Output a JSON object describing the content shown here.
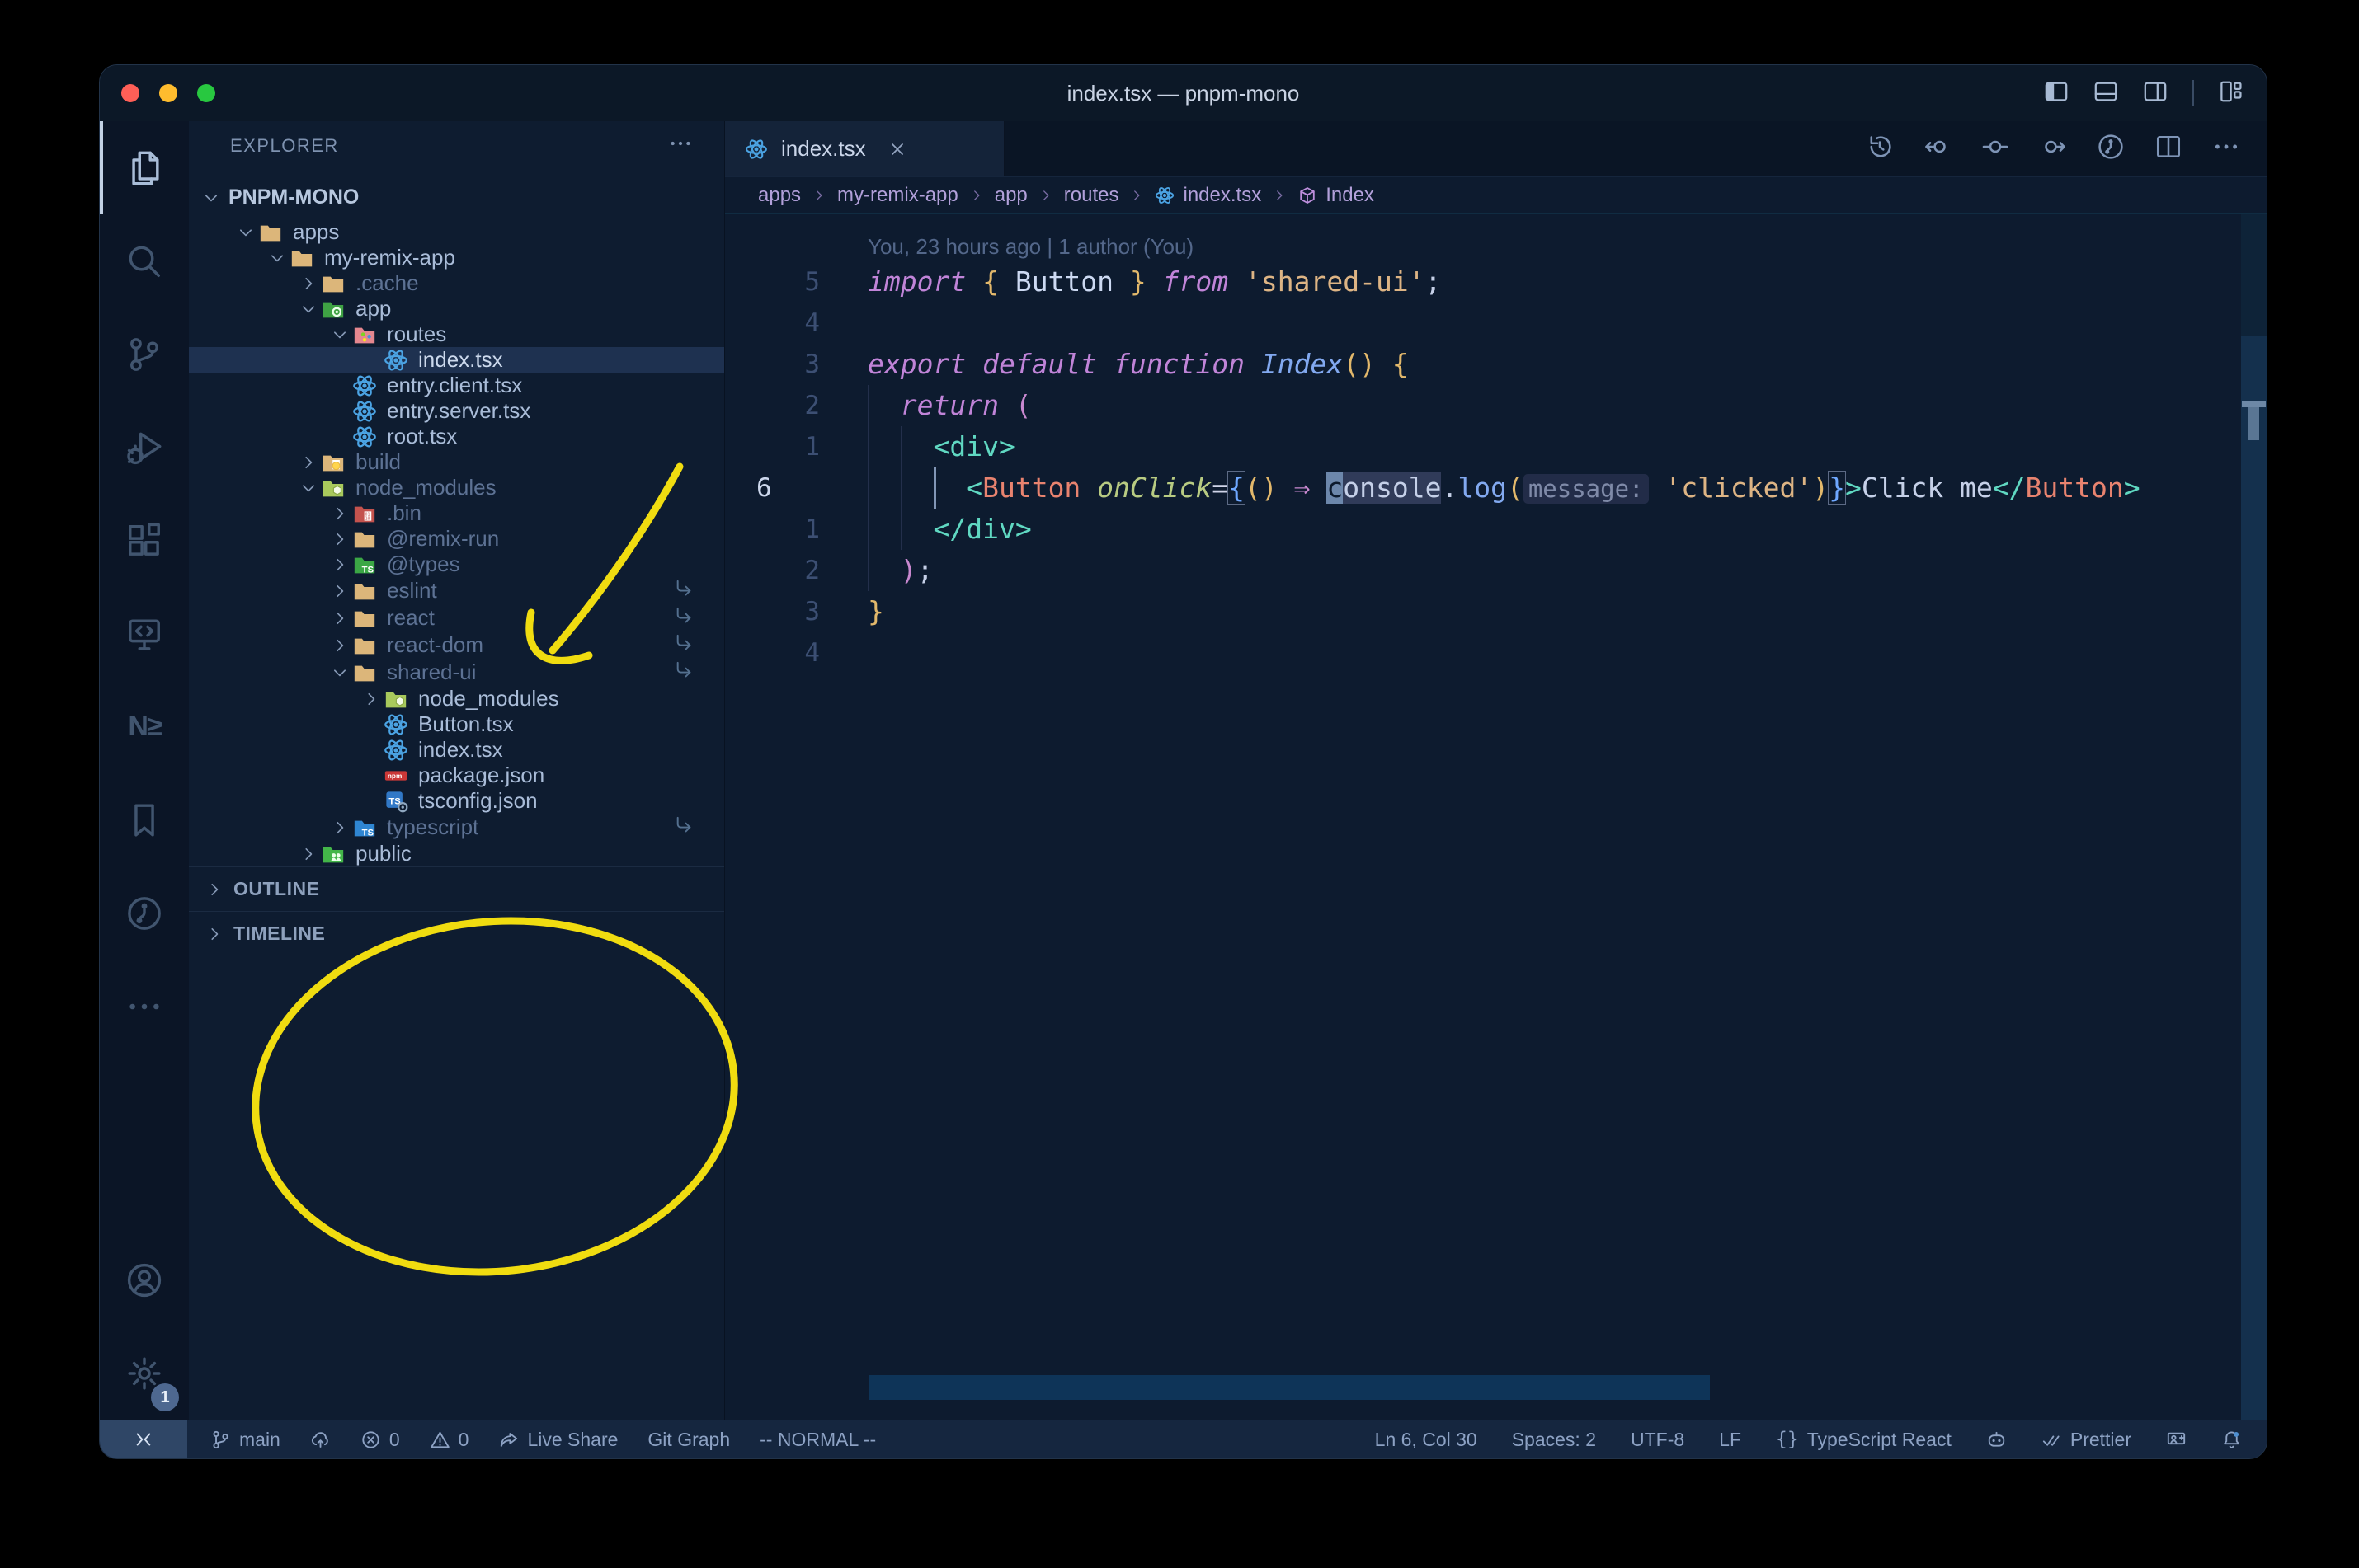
{
  "window": {
    "title": "index.tsx — pnpm-mono"
  },
  "title_bar": {
    "layout_icons": [
      "layout-sidebar-left",
      "layout-panel",
      "layout-sidebar-right",
      "sep",
      "layout-custom"
    ]
  },
  "activity_bar": {
    "items": [
      "files",
      "search",
      "scm",
      "debug",
      "extensions",
      "remote-explorer",
      "nx-console",
      "bookmarks",
      "gitlens",
      "ellipsis"
    ],
    "active_item": "files",
    "bottom_items": [
      "account",
      "settings"
    ],
    "settings_badge": "1"
  },
  "sidebar": {
    "header": "EXPLORER",
    "root": "PNPM-MONO",
    "sections": [
      "OUTLINE",
      "TIMELINE"
    ],
    "tree": [
      {
        "label": "apps",
        "icon": "folder-tan",
        "level": 0,
        "chevron": "down",
        "dim": false,
        "selected": false,
        "symlink": false
      },
      {
        "label": "my-remix-app",
        "icon": "folder-tan",
        "level": 1,
        "chevron": "down",
        "dim": false,
        "selected": false,
        "symlink": false
      },
      {
        "label": ".cache",
        "icon": "folder-tan",
        "level": 2,
        "chevron": "right",
        "dim": true,
        "selected": false,
        "symlink": false
      },
      {
        "label": "app",
        "icon": "folder-app",
        "level": 2,
        "chevron": "down",
        "dim": false,
        "selected": false,
        "symlink": false
      },
      {
        "label": "routes",
        "icon": "folder-routes",
        "level": 3,
        "chevron": "down",
        "dim": false,
        "selected": false,
        "symlink": false
      },
      {
        "label": "index.tsx",
        "icon": "react",
        "level": 4,
        "chevron": "",
        "dim": false,
        "selected": true,
        "symlink": false
      },
      {
        "label": "entry.client.tsx",
        "icon": "react",
        "level": 3,
        "chevron": "",
        "dim": false,
        "selected": false,
        "symlink": false
      },
      {
        "label": "entry.server.tsx",
        "icon": "react",
        "level": 3,
        "chevron": "",
        "dim": false,
        "selected": false,
        "symlink": false
      },
      {
        "label": "root.tsx",
        "icon": "react",
        "level": 3,
        "chevron": "",
        "dim": false,
        "selected": false,
        "symlink": false
      },
      {
        "label": "build",
        "icon": "folder-dist",
        "level": 2,
        "chevron": "right",
        "dim": true,
        "selected": false,
        "symlink": false
      },
      {
        "label": "node_modules",
        "icon": "folder-node",
        "level": 2,
        "chevron": "down",
        "dim": true,
        "selected": false,
        "symlink": false
      },
      {
        "label": ".bin",
        "icon": "folder-bin",
        "level": 3,
        "chevron": "right",
        "dim": true,
        "selected": false,
        "symlink": false
      },
      {
        "label": "@remix-run",
        "icon": "folder-tan",
        "level": 3,
        "chevron": "right",
        "dim": true,
        "selected": false,
        "symlink": false
      },
      {
        "label": "@types",
        "icon": "folder-types",
        "level": 3,
        "chevron": "right",
        "dim": true,
        "selected": false,
        "symlink": false
      },
      {
        "label": "eslint",
        "icon": "folder-tan",
        "level": 3,
        "chevron": "right",
        "dim": true,
        "selected": false,
        "symlink": true
      },
      {
        "label": "react",
        "icon": "folder-tan",
        "level": 3,
        "chevron": "right",
        "dim": true,
        "selected": false,
        "symlink": true
      },
      {
        "label": "react-dom",
        "icon": "folder-tan",
        "level": 3,
        "chevron": "right",
        "dim": true,
        "selected": false,
        "symlink": true
      },
      {
        "label": "shared-ui",
        "icon": "folder-tan",
        "level": 3,
        "chevron": "down",
        "dim": true,
        "selected": false,
        "symlink": true
      },
      {
        "label": "node_modules",
        "icon": "folder-node",
        "level": 4,
        "chevron": "right",
        "dim": false,
        "selected": false,
        "symlink": false
      },
      {
        "label": "Button.tsx",
        "icon": "react",
        "level": 4,
        "chevron": "",
        "dim": false,
        "selected": false,
        "symlink": false
      },
      {
        "label": "index.tsx",
        "icon": "react",
        "level": 4,
        "chevron": "",
        "dim": false,
        "selected": false,
        "symlink": false
      },
      {
        "label": "package.json",
        "icon": "npm",
        "level": 4,
        "chevron": "",
        "dim": false,
        "selected": false,
        "symlink": false
      },
      {
        "label": "tsconfig.json",
        "icon": "tsconfig",
        "level": 4,
        "chevron": "",
        "dim": false,
        "selected": false,
        "symlink": false
      },
      {
        "label": "typescript",
        "icon": "folder-ts",
        "level": 3,
        "chevron": "right",
        "dim": true,
        "selected": false,
        "symlink": true
      },
      {
        "label": "public",
        "icon": "folder-public",
        "level": 2,
        "chevron": "right",
        "dim": false,
        "selected": false,
        "symlink": false
      }
    ]
  },
  "editor": {
    "tab": {
      "label": "index.tsx",
      "icon": "react"
    },
    "toolbar_icons": [
      "history",
      "nav-back",
      "nav-dot",
      "nav-fwd",
      "gitlens-circle",
      "split",
      "ellipsis"
    ],
    "breadcrumbs": [
      {
        "label": "apps",
        "icon": ""
      },
      {
        "label": "my-remix-app",
        "icon": ""
      },
      {
        "label": "app",
        "icon": ""
      },
      {
        "label": "routes",
        "icon": ""
      },
      {
        "label": "index.tsx",
        "icon": "react"
      },
      {
        "label": "Index",
        "icon": "cube"
      }
    ],
    "blame": "You, 23 hours ago | 1 author (You)",
    "code_lines": [
      {
        "num": "5",
        "cur": false,
        "t": [
          [
            "kw",
            "import "
          ],
          [
            "brace",
            "{"
          ],
          [
            "comp",
            " Button "
          ],
          [
            "brace",
            "}"
          ],
          [
            "kw",
            " from "
          ],
          [
            "str",
            "'shared-ui'"
          ],
          [
            "pl",
            ";"
          ]
        ]
      },
      {
        "num": "4",
        "cur": false,
        "t": []
      },
      {
        "num": "3",
        "cur": false,
        "t": [
          [
            "kw",
            "export default function "
          ],
          [
            "fni",
            "Index"
          ],
          [
            "brace",
            "()"
          ],
          [
            "pl",
            " "
          ],
          [
            "brace",
            "{"
          ]
        ]
      },
      {
        "num": "2",
        "cur": false,
        "t": [
          [
            "pl",
            "  "
          ],
          [
            "kw",
            "return "
          ],
          [
            "pp",
            "("
          ]
        ]
      },
      {
        "num": "1",
        "cur": false,
        "t": [
          [
            "pl",
            "    "
          ],
          [
            "tag",
            "<div>"
          ]
        ]
      },
      {
        "num": "6",
        "cur": true,
        "t": [
          [
            "pl",
            "      "
          ],
          [
            "tag",
            "<"
          ],
          [
            "ctag",
            "Button"
          ],
          [
            "attr",
            " onClick"
          ],
          [
            "op",
            "="
          ],
          [
            "bm",
            "{"
          ],
          [
            "brace",
            "()"
          ],
          [
            "pl",
            " "
          ],
          [
            "arrow",
            "⇒"
          ],
          [
            "pl",
            " "
          ],
          [
            "cur",
            "c"
          ],
          [
            "whl",
            "onsole"
          ],
          [
            "pl",
            "."
          ],
          [
            "fn",
            "log"
          ],
          [
            "brace",
            "("
          ],
          [
            "inlay",
            "message:"
          ],
          [
            "pl",
            " "
          ],
          [
            "str",
            "'clicked'"
          ],
          [
            "brace",
            ")"
          ],
          [
            "bm",
            "}"
          ],
          [
            "tag",
            ">"
          ],
          [
            "pl",
            "Click me"
          ],
          [
            "tag",
            "</"
          ],
          [
            "ctag",
            "Button"
          ],
          [
            "tag",
            ">"
          ]
        ]
      },
      {
        "num": "1",
        "cur": false,
        "t": [
          [
            "pl",
            "    "
          ],
          [
            "tag",
            "</div>"
          ]
        ]
      },
      {
        "num": "2",
        "cur": false,
        "t": [
          [
            "pl",
            "  "
          ],
          [
            "pp",
            ")"
          ],
          [
            "pl",
            ";"
          ]
        ]
      },
      {
        "num": "3",
        "cur": false,
        "t": [
          [
            "brace",
            "}"
          ]
        ]
      },
      {
        "num": "4",
        "cur": false,
        "t": []
      }
    ]
  },
  "status_bar": {
    "left": [
      {
        "icon": "branch",
        "label": "main"
      },
      {
        "icon": "sync",
        "label": ""
      },
      {
        "icon": "error",
        "label": "0"
      },
      {
        "icon": "warning",
        "label": "0"
      },
      {
        "icon": "share",
        "label": "Live Share"
      },
      {
        "icon": "",
        "label": "Git Graph"
      },
      {
        "icon": "",
        "label": "-- NORMAL --"
      }
    ],
    "right": [
      {
        "icon": "",
        "label": "Ln 6, Col 30"
      },
      {
        "icon": "",
        "label": "Spaces: 2"
      },
      {
        "icon": "",
        "label": "UTF-8"
      },
      {
        "icon": "",
        "label": "LF"
      },
      {
        "icon": "braces",
        "label": "TypeScript React"
      },
      {
        "icon": "copilot",
        "label": ""
      },
      {
        "icon": "check2",
        "label": "Prettier"
      },
      {
        "icon": "person-screen",
        "label": ""
      },
      {
        "icon": "bell",
        "label": ""
      }
    ]
  },
  "annotations": {
    "color": "#f0dc10"
  },
  "colors": {
    "traffic_red": "#ff5f57",
    "traffic_yellow": "#febc2e",
    "traffic_green": "#28c840",
    "selected_row_bg": "#1e3150",
    "folder_tan": "#dcb67a",
    "react_blue": "#4ba3e3",
    "string": "#ddb484",
    "keyword": "#c084d8",
    "jsx_tag": "#e8836f"
  }
}
